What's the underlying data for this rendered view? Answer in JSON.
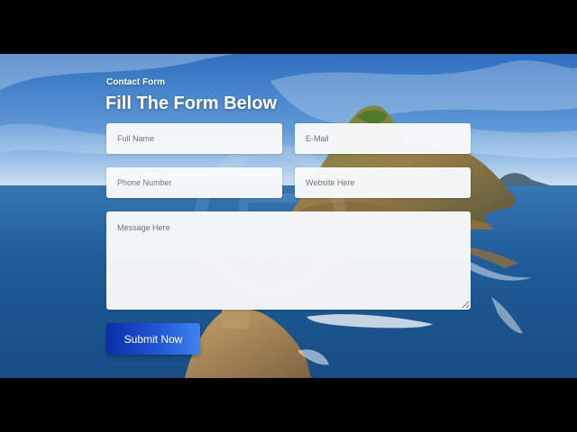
{
  "form": {
    "eyebrow": "Contact Form",
    "heading": "Fill The Form Below",
    "fields": {
      "full_name": {
        "placeholder": "Full Name",
        "value": ""
      },
      "email": {
        "placeholder": "E-Mail",
        "value": ""
      },
      "phone": {
        "placeholder": "Phone Number",
        "value": ""
      },
      "website": {
        "placeholder": "Website Here",
        "value": ""
      },
      "message": {
        "placeholder": "Message Here",
        "value": ""
      }
    },
    "submit_label": "Submit Now"
  },
  "watermark": {
    "text": "EASY WEBCODE"
  },
  "colors": {
    "button_start": "#0b2fa8",
    "button_end": "#3d84f0",
    "field_bg": "#f8fafc",
    "heading": "#ffffff"
  }
}
